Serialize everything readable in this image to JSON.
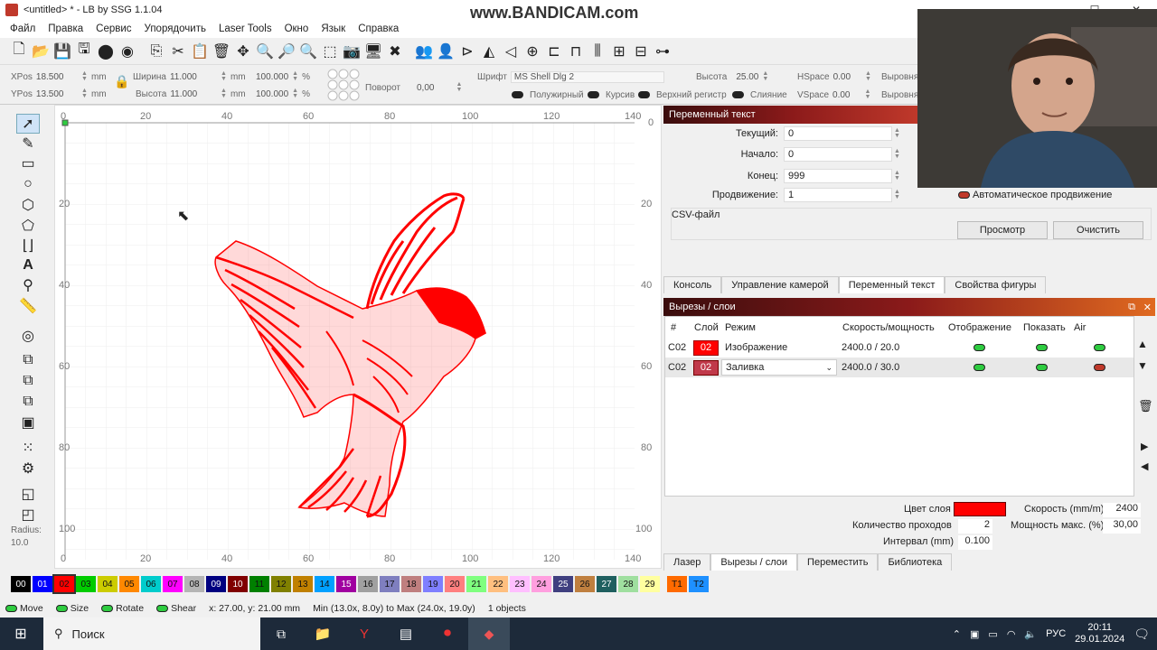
{
  "window": {
    "title": "<untitled> * - LB by SSG 1.1.04",
    "minimize": "—",
    "maximize": "☐",
    "close": "✕"
  },
  "watermark": "www.BANDICAM.com",
  "menu": [
    "Файл",
    "Правка",
    "Сервис",
    "Упорядочить",
    "Laser Tools",
    "Окно",
    "Язык",
    "Справка"
  ],
  "props": {
    "xpos_label": "XPos",
    "xpos": "18.500",
    "ypos_label": "YPos",
    "ypos": "13.500",
    "unit": "mm",
    "width_label": "Ширина",
    "width": "11.000",
    "height_label": "Высота",
    "height": "11.000",
    "scale_x": "100.000",
    "scale_y": "100.000",
    "percent": "%",
    "rotate_label": "Поворот",
    "rotate": "0,00",
    "font_label": "Шрифт",
    "font": "MS Shell Dlg 2",
    "text_height_label": "Высота",
    "text_height": "25.00",
    "hspace_label": "HSpace",
    "hspace": "0.00",
    "vspace_label": "VSpace",
    "vspace": "0.00",
    "align_label": "Выровня",
    "align_label2": "Выровня",
    "bold": "Полужирный",
    "italic": "Курсив",
    "upper": "Верхний регистр",
    "merge": "Слияние"
  },
  "ruler": {
    "top": [
      "0",
      "20",
      "40",
      "60",
      "80",
      "100",
      "120",
      "140"
    ],
    "left": [
      "20",
      "40",
      "60",
      "80",
      "100"
    ],
    "right": [
      "0",
      "20",
      "40",
      "60",
      "80",
      "100"
    ],
    "bottom": [
      "0",
      "20",
      "40",
      "60",
      "80",
      "100",
      "120",
      "140"
    ]
  },
  "left_tools": {
    "radius_label": "Radius:",
    "radius": "10.0"
  },
  "var_text": {
    "header": "Переменный текст",
    "current_label": "Текущий:",
    "current": "0",
    "start_label": "Начало:",
    "start": "0",
    "end_label": "Конец:",
    "end": "999",
    "advance_label": "Продвижение:",
    "advance": "1",
    "auto_advance": "Автоматическое продвижение",
    "csv_label": "CSV-файл",
    "browse": "Просмотр",
    "clear": "Очистить"
  },
  "tabs_top": [
    "Консоль",
    "Управление камерой",
    "Переменный текст",
    "Свойства фигуры"
  ],
  "layers": {
    "header": "Вырезы / слои",
    "columns": [
      "#",
      "Слой",
      "Режим",
      "Скорость/мощность",
      "Отображение",
      "Показать",
      "Air"
    ],
    "rows": [
      {
        "id": "C02",
        "layer": "02",
        "mode": "Изображение",
        "speed": "2400.0 / 20.0"
      },
      {
        "id": "C02",
        "layer": "02",
        "mode": "Заливка",
        "speed": "2400.0 / 30.0"
      }
    ],
    "color_label": "Цвет слоя",
    "speed_label": "Скорость (mm/m)",
    "speed": "2400",
    "passes_label": "Количество проходов",
    "passes": "2",
    "power_label": "Мощность макс. (%)",
    "power": "30,00",
    "interval_label": "Интервал (mm)",
    "interval": "0.100"
  },
  "tabs_bottom": [
    "Лазер",
    "Вырезы / слои",
    "Переместить",
    "Библиотека"
  ],
  "palette": [
    "00",
    "01",
    "02",
    "03",
    "04",
    "05",
    "06",
    "07",
    "08",
    "09",
    "10",
    "11",
    "12",
    "13",
    "14",
    "15",
    "16",
    "17",
    "18",
    "19",
    "20",
    "21",
    "22",
    "23",
    "24",
    "25",
    "26",
    "27",
    "28",
    "29",
    "T1",
    "T2"
  ],
  "palette_colors": [
    "#000000",
    "#0000ff",
    "#ff0000",
    "#00cc00",
    "#cccc00",
    "#ff8800",
    "#00cccc",
    "#ff00ff",
    "#b4b4b4",
    "#000080",
    "#800000",
    "#008000",
    "#808000",
    "#c08000",
    "#00a0ff",
    "#a000a0",
    "#a0a0a0",
    "#7f7fbf",
    "#bf7f7f",
    "#7f7fff",
    "#ff7f7f",
    "#7fff7f",
    "#ffbf7f",
    "#ffbfff",
    "#ff9fdf",
    "#3f3f7f",
    "#bf7f3f",
    "#1f5f5f",
    "#9fdf9f",
    "#ffff9f",
    "#ff6a00",
    "#1e90ff"
  ],
  "status": {
    "move": "Move",
    "size": "Size",
    "rotate": "Rotate",
    "shear": "Shear",
    "coords": "x: 27.00, y: 21.00 mm",
    "bounds": "Min (13.0x, 8.0y) to Max (24.0x, 19.0y)",
    "objects": "1 objects"
  },
  "taskbar": {
    "search": "Поиск",
    "lang": "РУС",
    "time": "20:11",
    "date": "29.01.2024"
  }
}
